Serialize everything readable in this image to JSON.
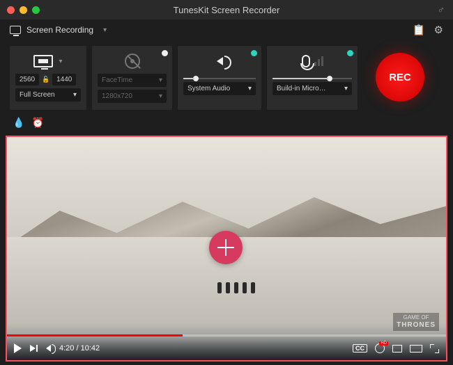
{
  "app": {
    "title": "TunesKit Screen Recorder"
  },
  "mode": {
    "label": "Screen Recording"
  },
  "display": {
    "width": "2560",
    "height": "1440",
    "preset": "Full Screen"
  },
  "camera": {
    "device": "FaceTime",
    "resolution": "1280x720",
    "enabled": false
  },
  "audio_out": {
    "device": "System Audio",
    "enabled": true
  },
  "mic": {
    "device": "Build-in Micro…",
    "enabled": true
  },
  "rec": {
    "label": "REC"
  },
  "video": {
    "current": "4:20",
    "total": "10:42",
    "progress_pct": 40,
    "watermark_top": "GAME OF",
    "watermark_main": "THRONES",
    "quality_badge": "HD",
    "cc": "CC"
  }
}
